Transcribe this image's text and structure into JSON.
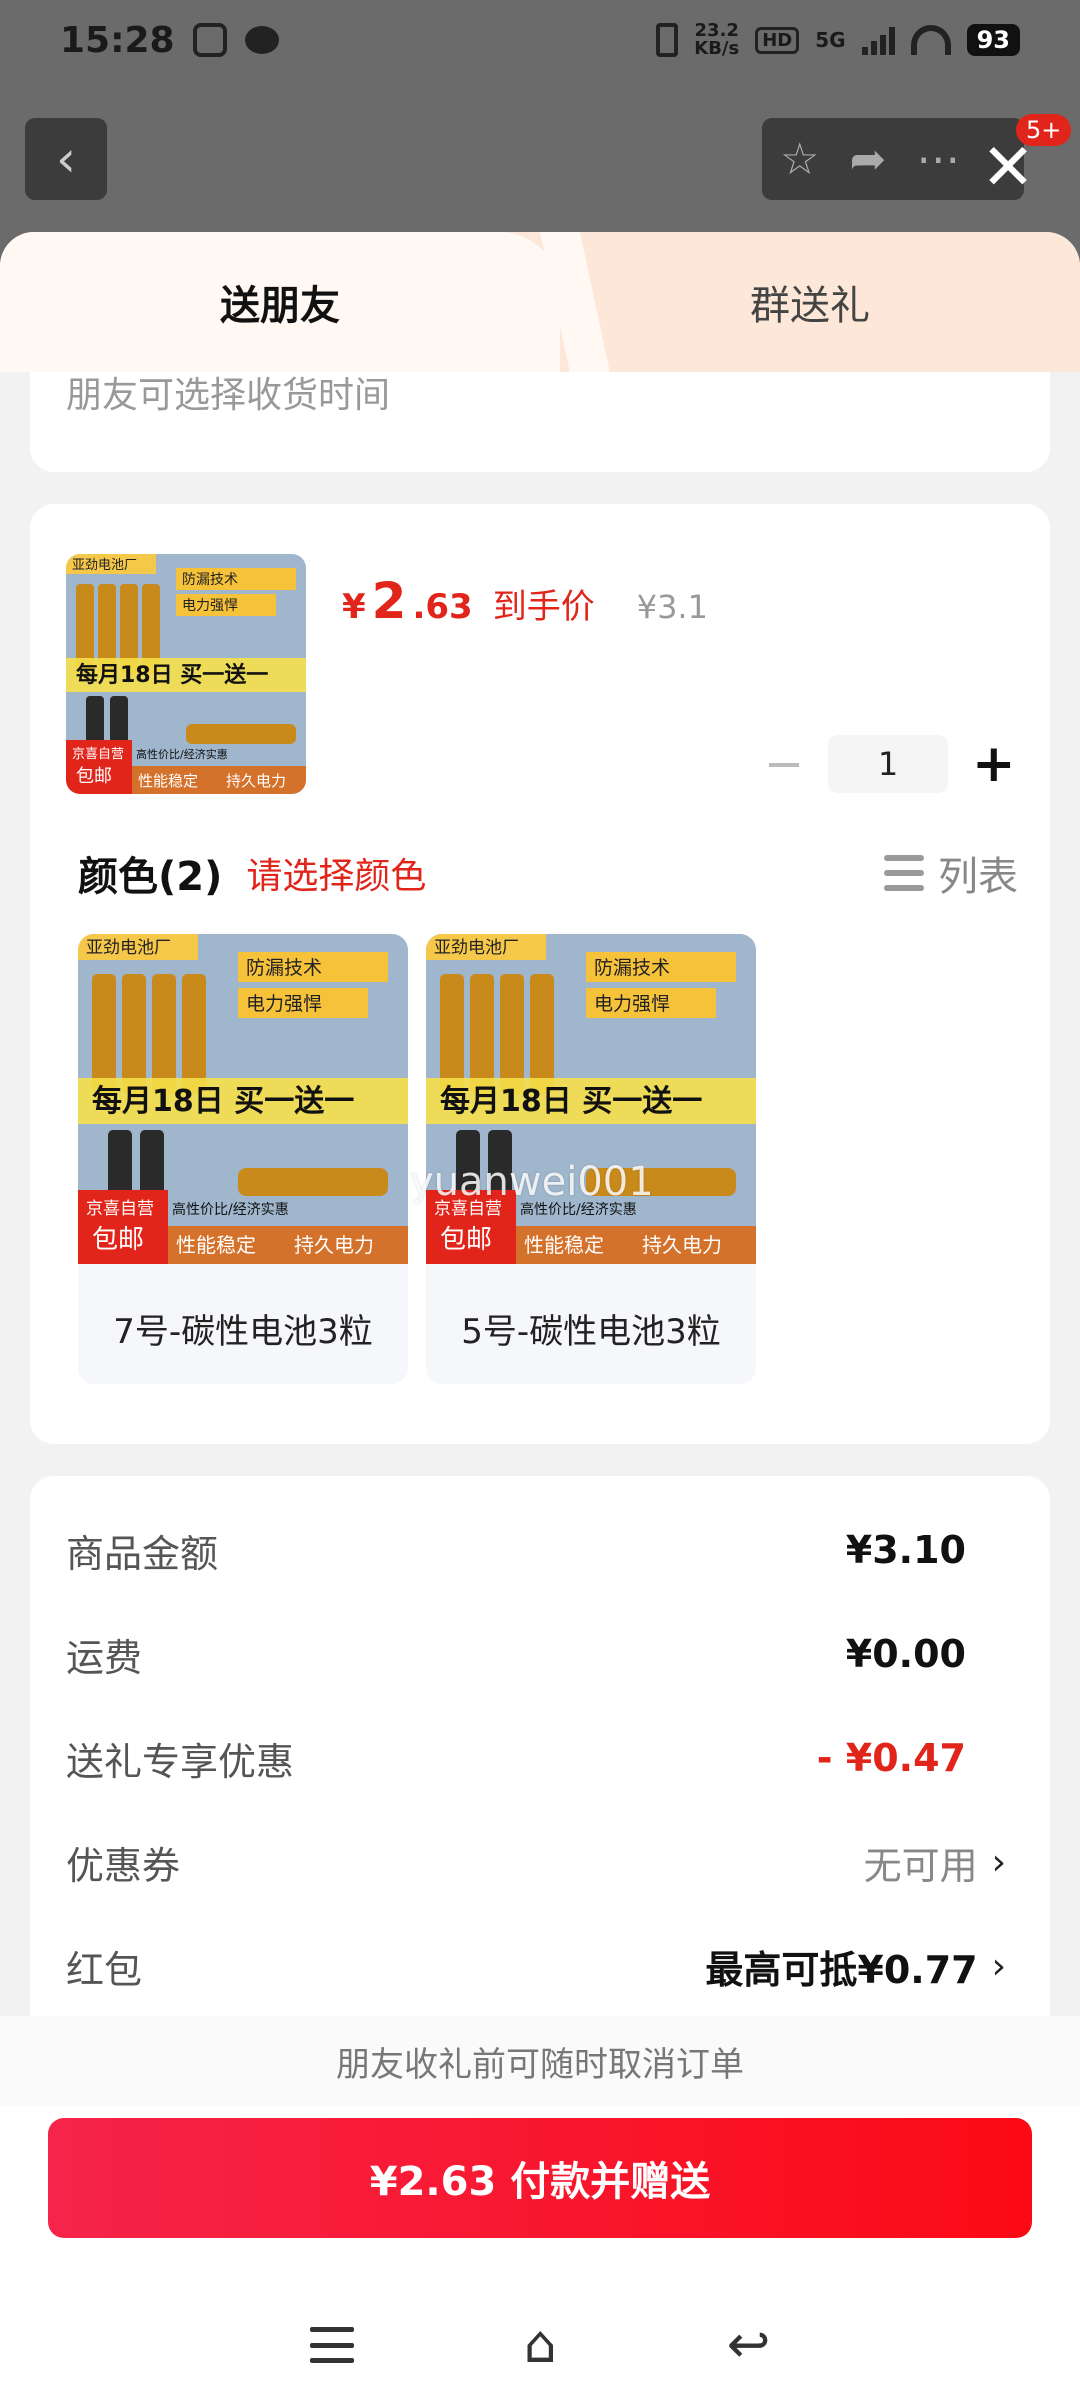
{
  "status_bar": {
    "time": "15:28",
    "net_speed_value": "23.2",
    "net_speed_unit": "KB/s",
    "hd": "HD",
    "network": "5G",
    "battery": "93"
  },
  "toolbar": {
    "badge": "5+"
  },
  "tabs": [
    "送朋友",
    "群送礼"
  ],
  "clipped_note": "朋友可选择收货时间",
  "product": {
    "image_brand": "亚劲电池厂",
    "image_features": [
      "防漏技术",
      "电力强悍"
    ],
    "image_promo": "每月18日 买一送一",
    "image_badge_line1": "京喜自营",
    "image_badge_line2": "包邮",
    "image_sub": "高性价比/经济实惠",
    "image_bottom": [
      "性能稳定",
      "持久电力"
    ],
    "price_currency": "¥",
    "price_integer": "2",
    "price_decimal": ".63",
    "price_tag": "到手价",
    "original_price": "¥3.1",
    "quantity": "1"
  },
  "colors": {
    "title": "颜色(2)",
    "hint": "请选择颜色",
    "list_toggle_label": "列表",
    "options": [
      "7号-碳性电池3粒",
      "5号-碳性电池3粒"
    ]
  },
  "watermark": "yuanwei001",
  "fees": {
    "goods_amount": {
      "label": "商品金额",
      "value": "¥3.10"
    },
    "shipping": {
      "label": "运费",
      "value": "¥0.00"
    },
    "gift_discount": {
      "label": "送礼专享优惠",
      "value": "- ¥0.47"
    },
    "coupon": {
      "label": "优惠券",
      "value": "无可用"
    },
    "red_packet": {
      "label": "红包",
      "value": "最高可抵¥0.77"
    }
  },
  "bottom": {
    "cancel_note": "朋友收礼前可随时取消订单",
    "pay_button": "¥2.63 付款并赠送"
  },
  "colors_theme": {
    "accent_red": "#e1251b",
    "tab_bg": "#fde7d9"
  },
  "icons": [
    "back-icon",
    "star-icon",
    "share-icon",
    "more-icon",
    "close-icon",
    "list-view-icon",
    "chevron-right-icon",
    "menu-icon",
    "home-icon",
    "nav-back-icon"
  ]
}
